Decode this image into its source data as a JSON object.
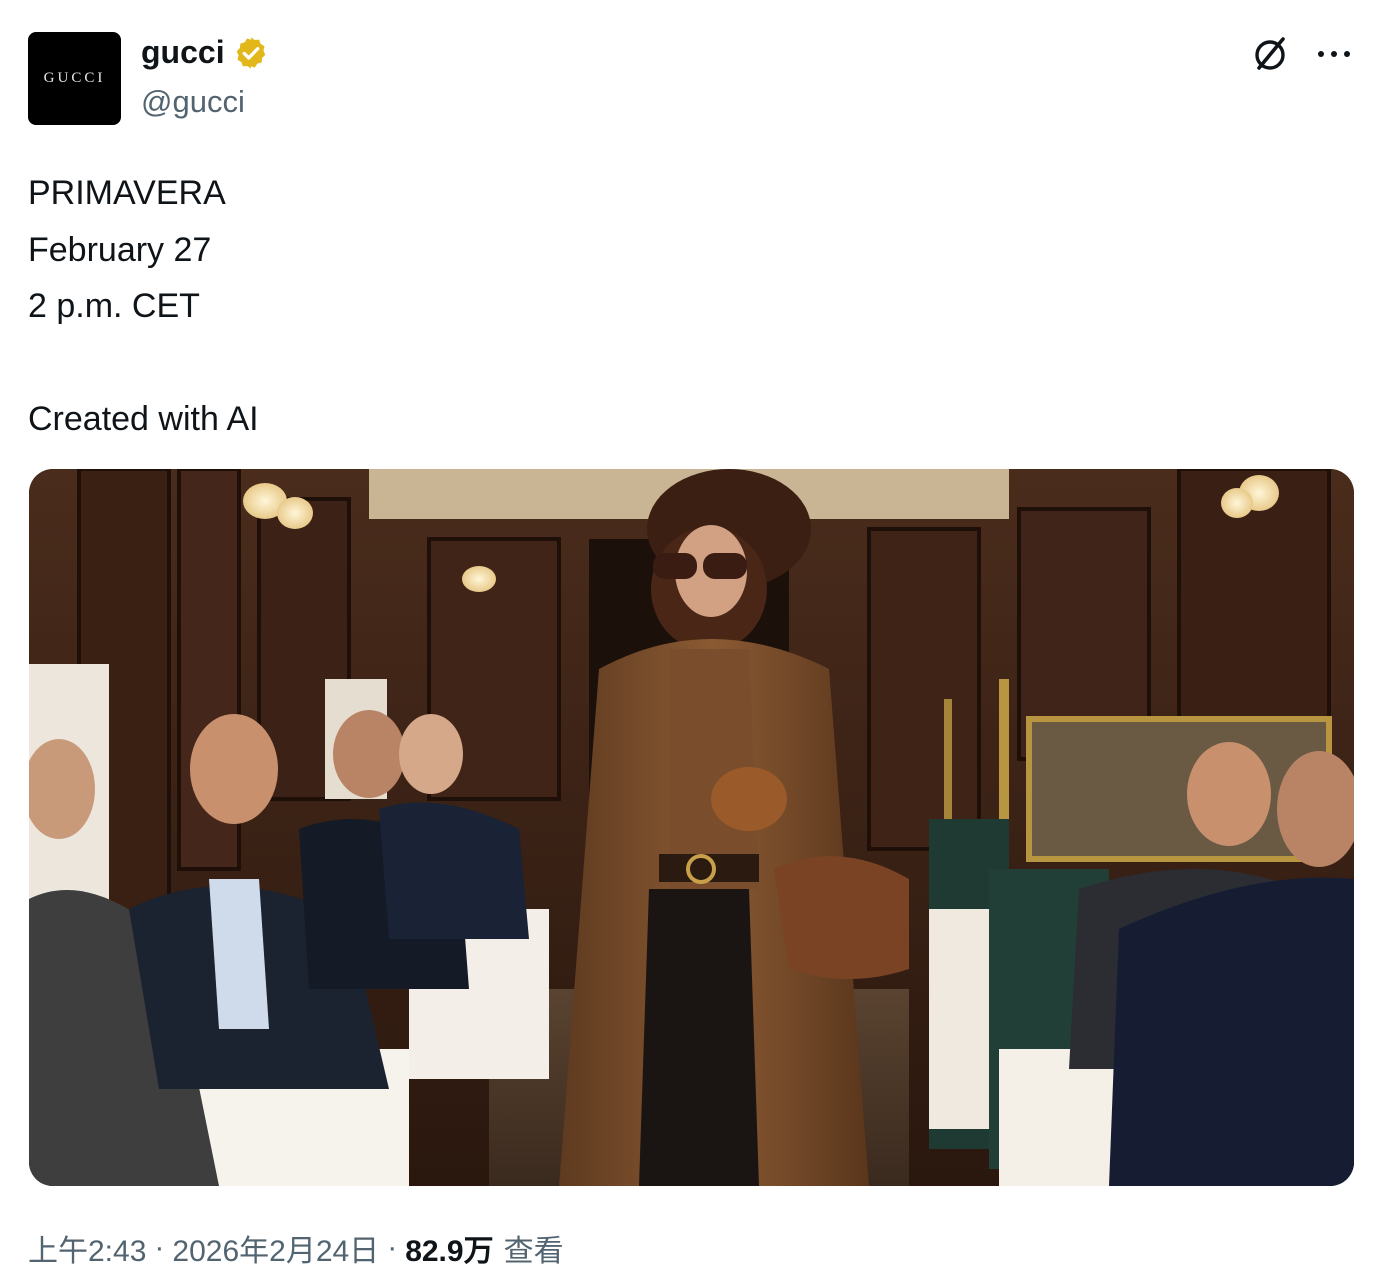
{
  "author": {
    "avatar_text": "GUCCI",
    "display_name": "gucci",
    "handle": "@gucci",
    "verified_color": "#e2b719"
  },
  "header_icons": [
    "grok-icon",
    "more-icon"
  ],
  "tweet": {
    "lines": [
      "PRIMAVERA",
      "February 27",
      "2 p.m. CET",
      "",
      "Created with AI"
    ]
  },
  "meta": {
    "time": "上午2:43",
    "separator": "·",
    "date": "2026年2月24日",
    "views_count": "82.9万",
    "views_label": "查看"
  },
  "colors": {
    "text_primary": "#0f1419",
    "text_secondary": "#536471"
  }
}
